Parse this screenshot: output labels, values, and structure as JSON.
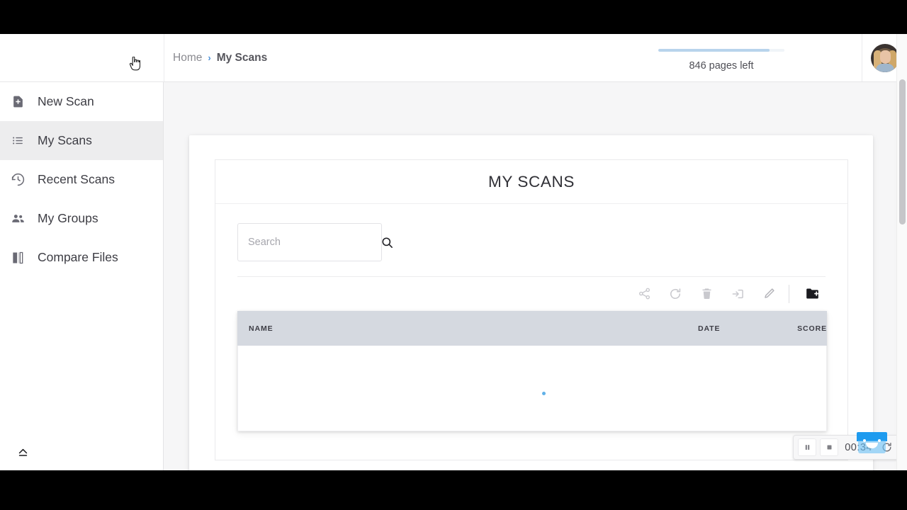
{
  "app": {
    "brand": "",
    "bg_color": "#f6f6f7",
    "accent_color": "#4a90d9"
  },
  "header": {
    "breadcrumb": {
      "home_label": "Home",
      "separator": "›",
      "current_label": "My Scans"
    },
    "quota": {
      "text": "846 pages left",
      "bar_fill_percent": 88,
      "bar_color": "#b8d4ec"
    },
    "avatar_name": "user-avatar"
  },
  "sidebar": {
    "items": [
      {
        "label": "New Scan",
        "icon": "new-document-icon",
        "active": false
      },
      {
        "label": "My Scans",
        "icon": "list-icon",
        "active": true
      },
      {
        "label": "Recent Scans",
        "icon": "history-clock-icon",
        "active": false
      },
      {
        "label": "My Groups",
        "icon": "people-icon",
        "active": false
      },
      {
        "label": "Compare Files",
        "icon": "compare-files-icon",
        "active": false
      }
    ],
    "collapse_icon": "eject-icon"
  },
  "panel": {
    "title": "MY SCANS",
    "search": {
      "placeholder": "Search",
      "value": "",
      "icon": "search-icon"
    },
    "toolbar": [
      {
        "name": "share-icon",
        "label": "Share"
      },
      {
        "name": "refresh-icon",
        "label": "Refresh"
      },
      {
        "name": "trash-icon",
        "label": "Delete"
      },
      {
        "name": "move-to-folder-icon",
        "label": "Move"
      },
      {
        "name": "pencil-icon",
        "label": "Rename"
      },
      {
        "name": "new-folder-icon",
        "label": "New Folder"
      }
    ],
    "table": {
      "columns": [
        "NAME",
        "DATE",
        "SCORE"
      ],
      "rows": [],
      "loading": true,
      "header_bg": "#d5d9e0",
      "loading_dot_color": "#61b1e8"
    }
  },
  "recorder": {
    "pause_label": "Pause",
    "stop_label": "Stop",
    "time": "00:34",
    "restart_label": "Restart",
    "extension_badge": "screen-recorder-extension-icon"
  }
}
